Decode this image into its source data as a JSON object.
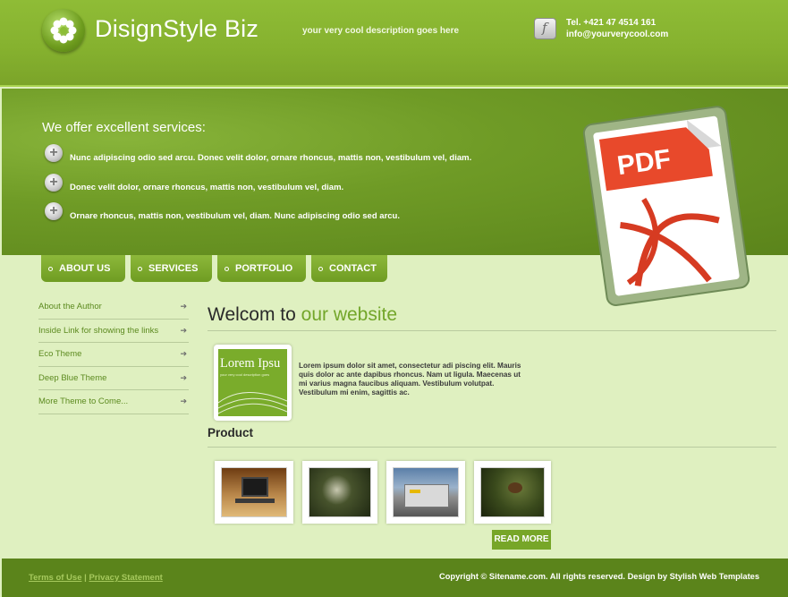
{
  "header": {
    "brand": "DisignStyle Biz",
    "tagline": "your very cool description goes here",
    "phone": "Tel. +421 47 4514 161",
    "email": "info@yourverycool.com"
  },
  "banner": {
    "title": "We offer excellent services:",
    "bullets": [
      "Nunc adipiscing odio sed arcu. Donec velit dolor, ornare rhoncus, mattis non, vestibulum vel, diam.",
      "Donec velit dolor, ornare rhoncus, mattis non, vestibulum vel, diam.",
      "Ornare rhoncus, mattis non, vestibulum vel, diam. Nunc adipiscing odio sed arcu."
    ],
    "pdf_label": "PDF"
  },
  "nav": [
    "ABOUT US",
    "SERVICES",
    "PORTFOLIO",
    "CONTACT"
  ],
  "sidebar": [
    "About the Author",
    "Inside Link for showing the links",
    "Eco Theme",
    "Deep Blue Theme",
    "More Theme to Come..."
  ],
  "main": {
    "welcome_prefix": "Welcom to",
    "welcome_highlight": "our website",
    "thumb_title": "Lorem Ipsu",
    "thumb_sub": "your very cool description goes",
    "intro": "Lorem ipsum dolor sit amet, consectetur adi piscing elit. Mauris quis dolor ac ante dapibus rhoncus. Nam ut ligula. Maecenas ut mi varius magna faucibus aliquam. Vestibulum volutpat. Vestibulum mi enim, sagittis ac.",
    "product_title": "Product",
    "read_more": "READ MORE"
  },
  "footer": {
    "terms": "Terms of Use",
    "separator": "|",
    "privacy": "Privacy Statement",
    "copyright": "Copyright © Sitename.com. All rights reserved. Design by Stylish Web Templates"
  },
  "colors": {
    "header_green": "#86b22f",
    "banner_green": "#6f9b26",
    "page_bg": "#dff0c0",
    "footer_green": "#5b841b",
    "accent_green": "#73a62a"
  }
}
